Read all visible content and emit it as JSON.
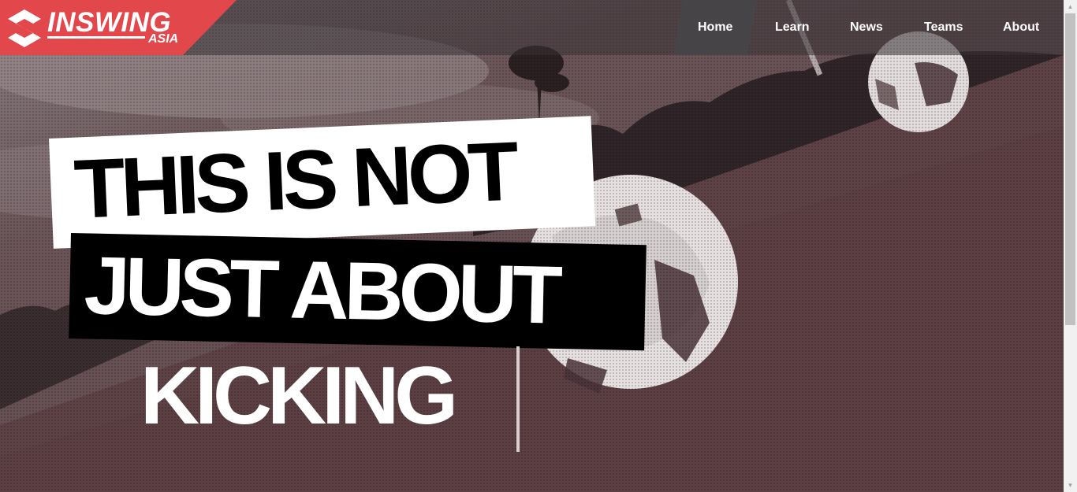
{
  "brand": {
    "name": "INSWING",
    "sub": "ASIA",
    "color": "#e2474b"
  },
  "nav": {
    "items": [
      {
        "label": "Home",
        "active": true
      },
      {
        "label": "Learn",
        "active": false
      },
      {
        "label": "News",
        "active": false
      },
      {
        "label": "Teams",
        "active": false
      },
      {
        "label": "About",
        "active": false
      }
    ]
  },
  "hero": {
    "line1": "THIS IS NOT",
    "line2": "JUST ABOUT",
    "line3": "KICKING"
  },
  "icons": {
    "logo": "inswing-logo-icon",
    "scroll_up": "scroll-up-arrow-icon",
    "scroll_down": "scroll-down-arrow-icon"
  }
}
